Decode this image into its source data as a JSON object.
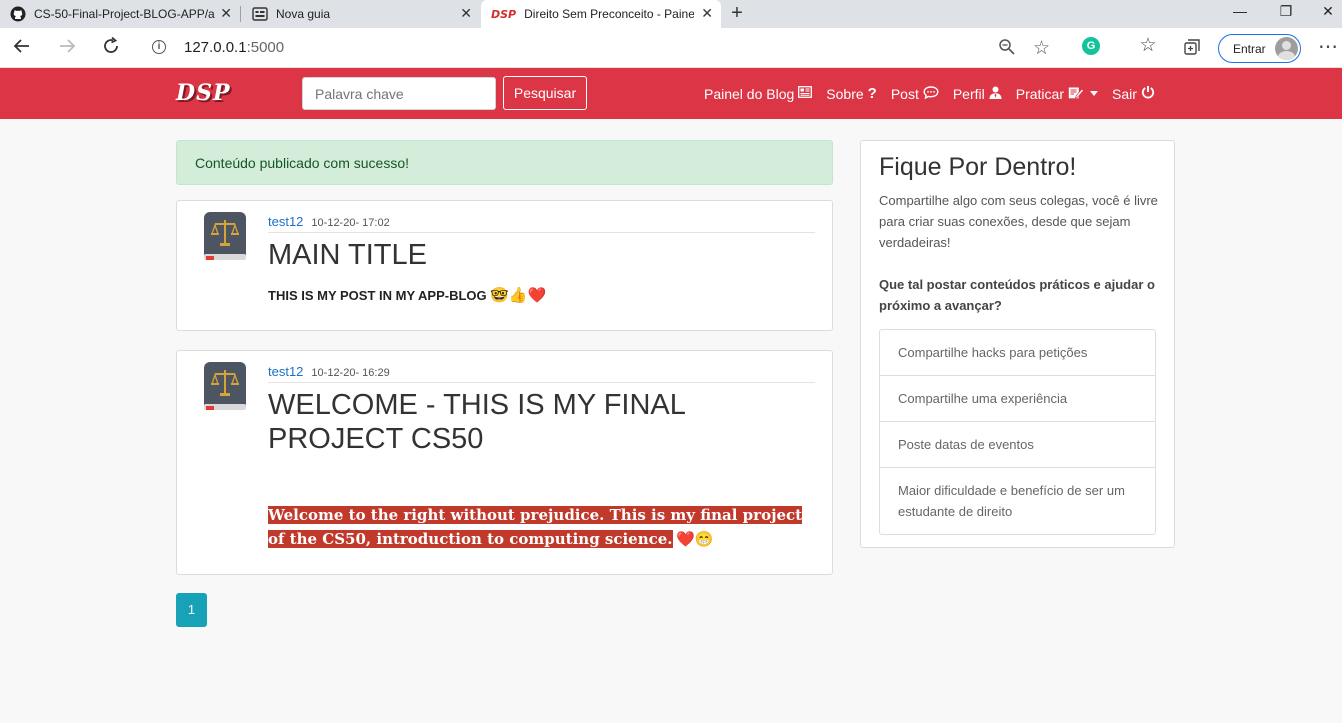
{
  "browser": {
    "tabs": [
      {
        "title": "CS-50-Final-Project-BLOG-APP/a",
        "icon": "github-icon",
        "active": false
      },
      {
        "title": "Nova guia",
        "icon": "newtab-page-icon",
        "active": false
      },
      {
        "title": "Direito Sem Preconceito - Painel",
        "icon": "dsp-favicon",
        "active": true
      }
    ],
    "url_host": "127.0.0.1",
    "url_port": ":5000",
    "signin_label": "Entrar"
  },
  "site": {
    "logo_text": "DSP",
    "search": {
      "placeholder": "Palavra chave",
      "button_label": "Pesquisar"
    },
    "nav": {
      "blog_panel": "Painel do Blog",
      "about": "Sobre",
      "post": "Post",
      "profile": "Perfil",
      "practice": "Praticar",
      "logout": "Sair"
    },
    "colors": {
      "brand": "#dc3545",
      "alert_bg": "#d4edda",
      "pager": "#17a2b8",
      "highlight": "#c0392b"
    }
  },
  "main": {
    "alert": "Conteúdo publicado com sucesso!",
    "posts": [
      {
        "author": "test12",
        "date": "10-12-20- 17:02",
        "title": "MAIN TITLE",
        "body": "THIS IS MY POST IN MY APP-BLOG",
        "emoji": "🤓👍❤️"
      },
      {
        "author": "test12",
        "date": "10-12-20- 16:29",
        "title": "WELCOME - THIS IS MY FINAL PROJECT CS50",
        "body": "Welcome to the right without prejudice.  This is my final project of the CS50, introduction to computing science.",
        "emoji": "❤️😁"
      }
    ],
    "pagination": {
      "current_page": "1"
    }
  },
  "sidebar": {
    "title": "Fique Por Dentro!",
    "text": "Compartilhe algo com seus colegas, você é livre para criar suas conexões, desde que sejam verdadeiras!",
    "question": "Que tal postar conteúdos práticos e ajudar o próximo a avançar?",
    "items": [
      {
        "label": "Compartilhe hacks para petições"
      },
      {
        "label": "Compartilhe uma experiência"
      },
      {
        "label": "Poste datas de eventos"
      },
      {
        "label": "Maior dificuldade e benefício de ser um estudante de direito"
      }
    ]
  }
}
